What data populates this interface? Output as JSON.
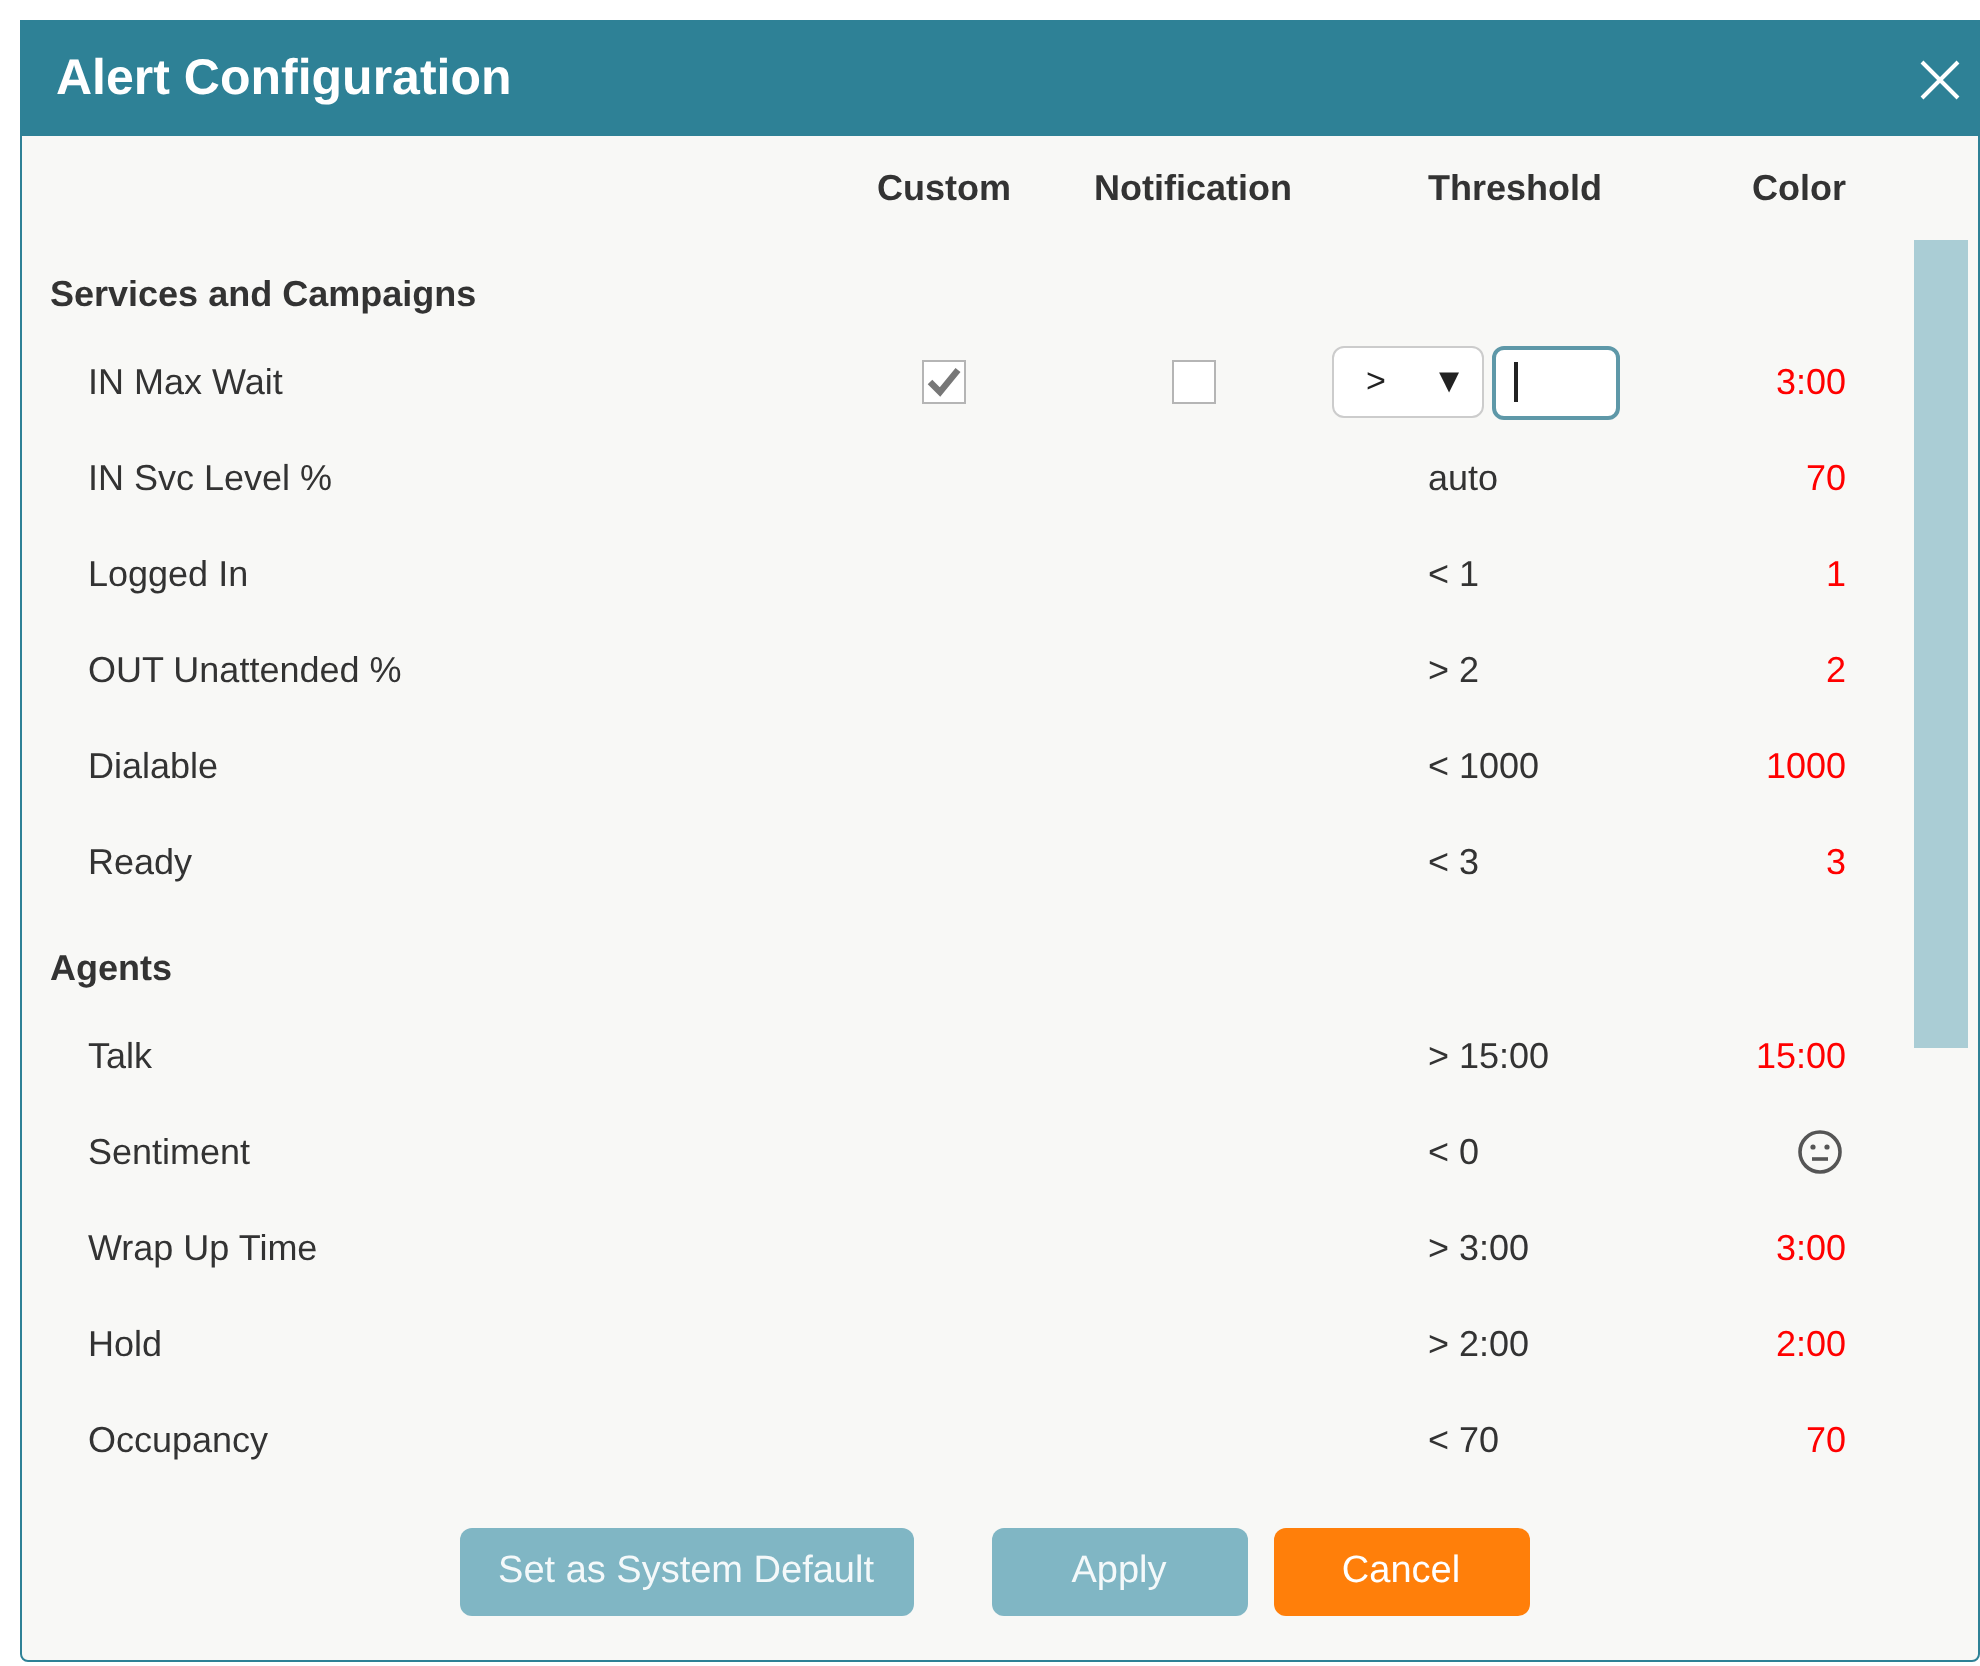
{
  "window": {
    "title": "Alert Configuration"
  },
  "columns": [
    "Custom",
    "Notification",
    "Threshold",
    "Color"
  ],
  "sections": [
    {
      "title": "Services and Campaigns",
      "rows": [
        {
          "kind": "editable",
          "label": "IN Max Wait",
          "custom": true,
          "notification": false,
          "operator": ">",
          "caret": "▼",
          "indicator": {
            "kind": "text",
            "text": "3:00"
          }
        },
        {
          "kind": "fixed",
          "label": "IN Svc Level %",
          "threshold": "auto",
          "indicator": {
            "kind": "text",
            "text": "70"
          }
        },
        {
          "kind": "fixed",
          "label": "Logged In",
          "threshold": "< 1",
          "indicator": {
            "kind": "text",
            "text": "1"
          }
        },
        {
          "kind": "fixed",
          "label": "OUT Unattended %",
          "threshold": "> 2",
          "indicator": {
            "kind": "text",
            "text": "2"
          }
        },
        {
          "kind": "fixed",
          "label": "Dialable",
          "threshold": "< 1000",
          "indicator": {
            "kind": "text",
            "text": "1000"
          }
        },
        {
          "kind": "fixed",
          "label": "Ready",
          "threshold": "< 3",
          "indicator": {
            "kind": "text",
            "text": "3"
          }
        }
      ]
    },
    {
      "title": "Agents",
      "rows": [
        {
          "kind": "fixed",
          "label": "Talk",
          "threshold": "> 15:00",
          "indicator": {
            "kind": "text",
            "text": "15:00"
          }
        },
        {
          "kind": "fixed",
          "label": "Sentiment",
          "threshold": "< 0",
          "indicator": {
            "kind": "face"
          }
        },
        {
          "kind": "fixed",
          "label": "Wrap Up Time",
          "threshold": "> 3:00",
          "indicator": {
            "kind": "text",
            "text": "3:00"
          }
        },
        {
          "kind": "fixed",
          "label": "Hold",
          "threshold": "> 2:00",
          "indicator": {
            "kind": "text",
            "text": "2:00"
          }
        },
        {
          "kind": "fixed",
          "label": "Occupancy",
          "threshold": "< 70",
          "indicator": {
            "kind": "text",
            "text": "70"
          }
        }
      ]
    }
  ],
  "buttons": [
    {
      "label": "Set as System Default",
      "kind": "secondary"
    },
    {
      "label": "Apply",
      "kind": "secondary"
    },
    {
      "label": "Cancel",
      "kind": "primary"
    }
  ]
}
